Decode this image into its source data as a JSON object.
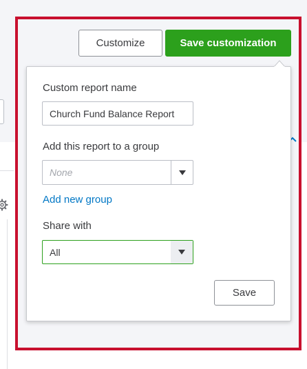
{
  "toolbar": {
    "customize_label": "Customize",
    "save_customization_label": "Save customization"
  },
  "popover": {
    "report_name_label": "Custom report name",
    "report_name_value": "Church Fund Balance Report",
    "group_label": "Add this report to a group",
    "group_placeholder": "None",
    "add_group_link": "Add new group",
    "share_label": "Share with",
    "share_value": "All",
    "save_label": "Save"
  },
  "colors": {
    "primary_green": "#2ca01c",
    "link_blue": "#0077c5",
    "highlight_red": "#c8102e",
    "text": "#393a3d"
  },
  "icons": {
    "select_caret": "triangle-down-icon",
    "background_gear": "gear-icon",
    "background_caret": "chevron-up-icon"
  }
}
